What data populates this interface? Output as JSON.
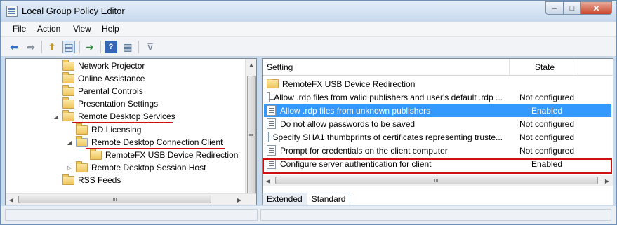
{
  "window": {
    "title": "Local Group Policy Editor"
  },
  "caption": {
    "min": "–",
    "max": "□",
    "close": "✕"
  },
  "menu": [
    "File",
    "Action",
    "View",
    "Help"
  ],
  "toolbar": [
    "back",
    "forward",
    "up-folder",
    "show-hide-tree",
    "export-list",
    "help",
    "properties",
    "filter"
  ],
  "tree": [
    {
      "label": "Network Projector",
      "level": 0,
      "expander": ""
    },
    {
      "label": "Online Assistance",
      "level": 0,
      "expander": ""
    },
    {
      "label": "Parental Controls",
      "level": 0,
      "expander": ""
    },
    {
      "label": "Presentation Settings",
      "level": 0,
      "expander": ""
    },
    {
      "label": "Remote Desktop Services",
      "level": 0,
      "expander": "◢"
    },
    {
      "label": "RD Licensing",
      "level": 1,
      "expander": ""
    },
    {
      "label": "Remote Desktop Connection Client",
      "level": 1,
      "expander": "◢"
    },
    {
      "label": "RemoteFX USB Device Redirection",
      "level": 2,
      "expander": ""
    },
    {
      "label": "Remote Desktop Session Host",
      "level": 1,
      "expander": "▷"
    },
    {
      "label": "RSS Feeds",
      "level": 0,
      "expander": ""
    }
  ],
  "list": {
    "columns": {
      "setting": "Setting",
      "state": "State"
    },
    "rows": [
      {
        "name": "RemoteFX USB Device Redirection",
        "state": "",
        "type": "folder"
      },
      {
        "name": "Allow .rdp files from valid publishers and user's default .rdp ...",
        "state": "Not configured",
        "type": "policy"
      },
      {
        "name": "Allow .rdp files from unknown publishers",
        "state": "Enabled",
        "type": "policy",
        "selected": true
      },
      {
        "name": "Do not allow passwords to be saved",
        "state": "Not configured",
        "type": "policy"
      },
      {
        "name": "Specify SHA1 thumbprints of certificates representing truste...",
        "state": "Not configured",
        "type": "policy"
      },
      {
        "name": "Prompt for credentials on the client computer",
        "state": "Not configured",
        "type": "policy"
      },
      {
        "name": "Configure server authentication for client",
        "state": "Enabled",
        "type": "policy"
      }
    ]
  },
  "tabs": [
    "Extended",
    "Standard"
  ]
}
